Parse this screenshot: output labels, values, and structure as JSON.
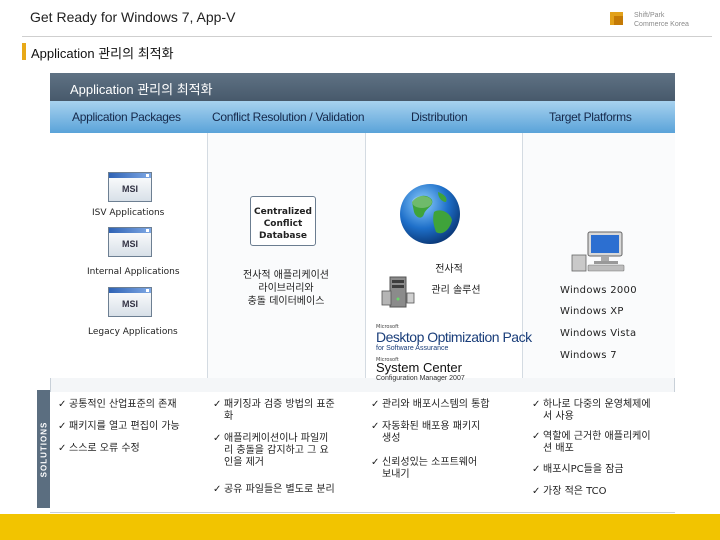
{
  "slide": {
    "title": "Get Ready for Windows 7, App-V",
    "brand_line1": "Shift/Park",
    "brand_line2": "Commerce Korea",
    "subhead": "Application 관리의 최적화"
  },
  "diagram": {
    "banner": "Application 관리의 최적화",
    "columns": [
      "Application Packages",
      "Conflict Resolution / Validation",
      "Distribution",
      "Target Platforms"
    ],
    "msi_label": "MSI",
    "packages": [
      "ISV Applications",
      "Internal Applications",
      "Legacy Applications"
    ],
    "database_lines": [
      "Centralized",
      "Conflict",
      "Database"
    ],
    "conflict_korean": [
      "전사적 애플리케이션",
      "라이브러리와",
      "충돌 데이터베이스"
    ],
    "distribution_korean": [
      "전사적",
      "관리 솔루션"
    ],
    "mdop": {
      "ms_small": "Microsoft",
      "name": "Desktop Optimization Pack",
      "sub": "for Software Assurance"
    },
    "sccm": {
      "ms_small": "Microsoft",
      "name": "System Center",
      "sub": "Configuration Manager 2007"
    },
    "platforms": [
      "Windows 2000",
      "Windows XP",
      "Windows Vista",
      "Windows 7"
    ]
  },
  "solutions": {
    "label": "SOLUTIONS",
    "check": "✓",
    "col1": [
      "공통적인 산업표준의 존재",
      "패키지를 열고 편집이 가능",
      "스스로 오류 수정"
    ],
    "col2": [
      [
        "패키징과 검증 방법의 표준",
        "화"
      ],
      [
        "애플리케이션이나 파일끼",
        "리 충돌을 감지하고 그 요",
        "인을 제거"
      ],
      [
        "공유 파일들은 별도로 분리"
      ]
    ],
    "col3": [
      [
        "관리와 배포시스템의 통합"
      ],
      [
        "자동화된 배포용 패키지",
        "생성"
      ],
      [
        "신뢰성있는 소프트웨어",
        "보내기"
      ]
    ],
    "col4": [
      [
        "하나로 다중의 운영체제에",
        "서 사용"
      ],
      [
        "역할에 근거한 애플리케이",
        "션 배포"
      ],
      [
        "배포시PC들을 잠금"
      ],
      [
        "가장 적은 TCO"
      ]
    ]
  },
  "colors": {
    "accent": "#e8a917",
    "banner": "#4f6275",
    "header_blue": "#5aa3d9",
    "footer": "#f2c400"
  }
}
